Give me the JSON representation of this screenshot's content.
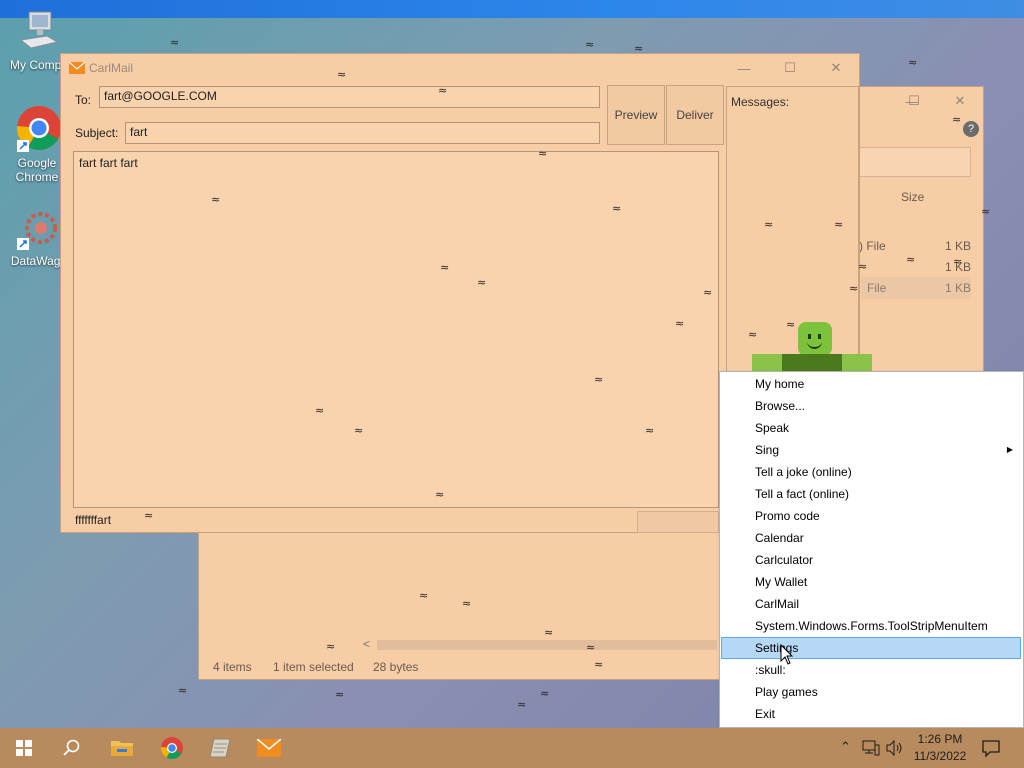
{
  "desktop": {
    "icons": [
      {
        "label": "My Compu",
        "icon": "computer-icon"
      },
      {
        "label": "Google Chrome",
        "icon": "chrome-icon"
      },
      {
        "label": "DataWago",
        "icon": "datawagon-icon"
      }
    ]
  },
  "carlmail": {
    "title": "CarlMail",
    "to_label": "To:",
    "to_value": "fart@GOOGLE.COM",
    "subject_label": "Subject:",
    "subject_value": "fart",
    "body_value": "fart fart fart",
    "preview_label": "Preview",
    "deliver_label": "Deliver",
    "messages_label": "Messages:",
    "status_text": "fffffffart"
  },
  "explorer": {
    "size_header": "Size",
    "rows": [
      {
        "type": ") File",
        "size": "1 KB"
      },
      {
        "type": "",
        "size": "1 KB"
      },
      {
        "type": "File",
        "size": "1 KB"
      }
    ],
    "status": {
      "items": "4 items",
      "selected": "1 item selected",
      "bytes": "28 bytes"
    },
    "scroll_left": "<"
  },
  "context_menu": {
    "items": [
      {
        "label": "My home"
      },
      {
        "label": "Browse..."
      },
      {
        "label": "Speak"
      },
      {
        "label": "Sing",
        "submenu": true
      },
      {
        "label": "Tell a joke (online)"
      },
      {
        "label": "Tell a fact (online)"
      },
      {
        "label": "Promo code"
      },
      {
        "label": "Calendar"
      },
      {
        "label": "Carlculator"
      },
      {
        "label": "My Wallet"
      },
      {
        "label": "CarlMail"
      },
      {
        "label": "System.Windows.Forms.ToolStripMenuItem"
      },
      {
        "label": "Settings",
        "highlighted": true
      },
      {
        "label": ":skull:"
      },
      {
        "label": "Play games"
      },
      {
        "label": "Exit"
      }
    ]
  },
  "taskbar": {
    "time": "1:26 PM",
    "date": "11/3/2022",
    "apps": [
      "start-icon",
      "search-icon",
      "file-explorer-icon",
      "chrome-icon",
      "notepad-icon",
      "carlmail-icon"
    ]
  },
  "colors": {
    "accent": "#f7cda6",
    "menu_highlight": "#b7d8f5",
    "taskbar": "#b88b5f",
    "buddy_green": "#7cc23a"
  }
}
